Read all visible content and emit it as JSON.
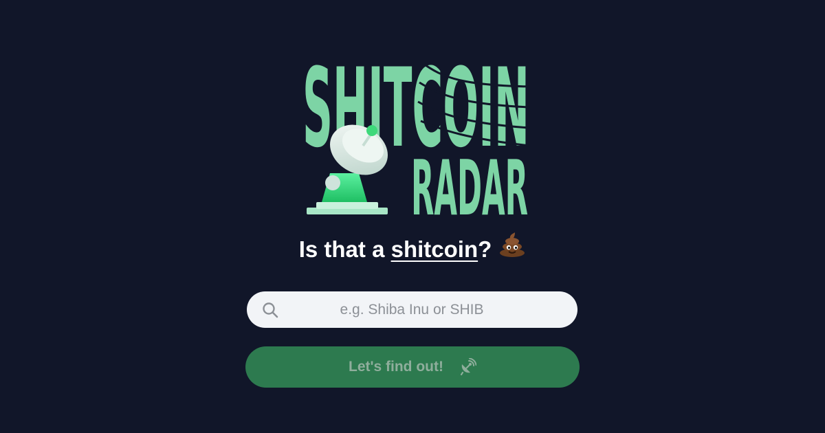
{
  "logo": {
    "line1": "SHITCOIN",
    "line2": "RADAR",
    "icon": "satellite-dish-icon"
  },
  "tagline": {
    "prefix": "Is that a ",
    "link": "shitcoin",
    "suffix": "?",
    "emoji": "poop-emoji"
  },
  "search": {
    "placeholder": "e.g. Shiba Inu or SHIB",
    "value": "",
    "icon": "search-icon"
  },
  "cta": {
    "label": "Let's find out!",
    "icon": "satellite-icon"
  },
  "colors": {
    "background": "#111629",
    "logo_green": "#7dd4a5",
    "button_green": "#2d7a4f",
    "button_text": "#8fae9c",
    "search_bg": "#f2f4f7"
  }
}
